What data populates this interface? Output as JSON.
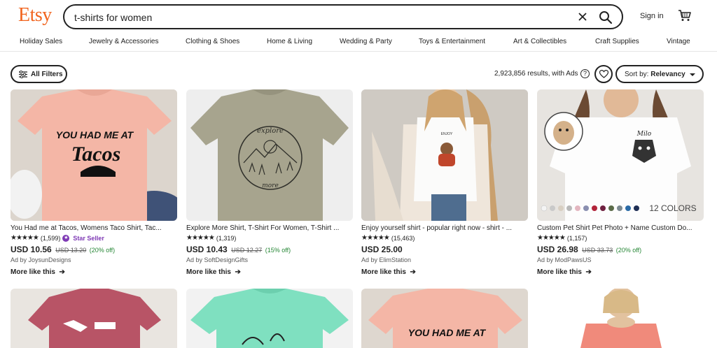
{
  "header": {
    "logo": "Etsy",
    "search_value": "t-shirts for women",
    "signin": "Sign in"
  },
  "categories": [
    "Holiday Sales",
    "Jewelry & Accessories",
    "Clothing & Shoes",
    "Home & Living",
    "Wedding & Party",
    "Toys & Entertainment",
    "Art & Collectibles",
    "Craft Supplies",
    "Vintage"
  ],
  "toolbar": {
    "filters_label": "All Filters",
    "results_text": "2,923,856 results, with Ads",
    "help_glyph": "?",
    "sort_prefix": "Sort by: ",
    "sort_value": "Relevancy"
  },
  "listings": [
    {
      "title": "You Had me at Tacos, Womens Taco Shirt, Tac...",
      "stars": "★★★★★",
      "reviews": "(1,599)",
      "badge": "Star Seller",
      "price": "USD 10.56",
      "original_price": "USD 13.20",
      "discount": "(20% off)",
      "shop": "Ad by JoysunDesigns",
      "more": "More like this",
      "image_text_1": "YOU HAD ME AT",
      "image_text_2": "Tacos"
    },
    {
      "title": "Explore More Shirt, T-Shirt For Women, T-Shirt ...",
      "stars": "★★★★★",
      "reviews": "(1,319)",
      "price": "USD 10.43",
      "original_price": "USD 12.27",
      "discount": "(15% off)",
      "shop": "Ad by SoftDesignGifts",
      "more": "More like this",
      "image_text_1": "explore",
      "image_text_2": "more"
    },
    {
      "title": "Enjoy yourself shirt - popular right now - shirt - ...",
      "stars": "★★★★★",
      "reviews": "(15,463)",
      "price": "USD 25.00",
      "shop": "Ad by ElimStation",
      "more": "More like this",
      "image_text_1": "ENJOY\nYOURSELF"
    },
    {
      "title": "Custom Pet Shirt Pet Photo + Name Custom Do...",
      "stars": "★★★★★",
      "reviews": "(1,157)",
      "price": "USD 26.98",
      "original_price": "USD 33.73",
      "discount": "(20% off)",
      "shop": "Ad by ModPawsUS",
      "more": "More like this",
      "image_text_1": "Milo",
      "image_text_2": "12 COLORS"
    }
  ],
  "row2_image_text": "YOU HAD ME AT",
  "colors": {
    "brand": "#f1641e",
    "star_seller": "#7f3ab5",
    "discount": "#258635"
  },
  "icons": [
    "close-icon",
    "search-icon",
    "cart-icon",
    "filter-icon",
    "help-icon",
    "heart-icon",
    "arrow-right-icon",
    "star-seller-icon"
  ]
}
